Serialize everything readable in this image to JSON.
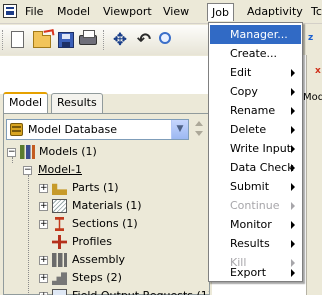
{
  "menubar": {
    "items": [
      "File",
      "Model",
      "Viewport",
      "View",
      "Job",
      "Adaptivity",
      "Tc"
    ]
  },
  "viewport": {
    "axis_z": "z",
    "axis_x": "x",
    "module_label": "Modu"
  },
  "tabs": [
    "Model",
    "Results"
  ],
  "model_select": {
    "value": "Model Database"
  },
  "tree": {
    "models": "Models (1)",
    "model1": "Model-1",
    "parts": "Parts (1)",
    "materials": "Materials (1)",
    "sections": "Sections (1)",
    "profiles": "Profiles",
    "assembly": "Assembly",
    "steps": "Steps (2)",
    "field_output": "Field Output Requests (1)"
  },
  "job_menu": {
    "items": [
      {
        "label": "Manager...",
        "submenu": false,
        "enabled": true,
        "highlighted": true
      },
      {
        "label": "Create...",
        "submenu": false,
        "enabled": true,
        "highlighted": false
      },
      {
        "label": "Edit",
        "submenu": true,
        "enabled": true,
        "highlighted": false
      },
      {
        "label": "Copy",
        "submenu": true,
        "enabled": true,
        "highlighted": false
      },
      {
        "label": "Rename",
        "submenu": true,
        "enabled": true,
        "highlighted": false
      },
      {
        "label": "Delete",
        "submenu": true,
        "enabled": true,
        "highlighted": false
      },
      {
        "label": "Write Input",
        "submenu": true,
        "enabled": true,
        "highlighted": false
      },
      {
        "label": "Data Check",
        "submenu": true,
        "enabled": true,
        "highlighted": false
      },
      {
        "label": "Submit",
        "submenu": true,
        "enabled": true,
        "highlighted": false
      },
      {
        "label": "Continue",
        "submenu": true,
        "enabled": false,
        "highlighted": false
      },
      {
        "label": "Monitor",
        "submenu": true,
        "enabled": true,
        "highlighted": false
      },
      {
        "label": "Results",
        "submenu": true,
        "enabled": true,
        "highlighted": false
      },
      {
        "label": "Kill",
        "submenu": true,
        "enabled": false,
        "highlighted": false
      },
      {
        "label": "Export",
        "submenu": true,
        "enabled": true,
        "highlighted": false
      }
    ]
  }
}
